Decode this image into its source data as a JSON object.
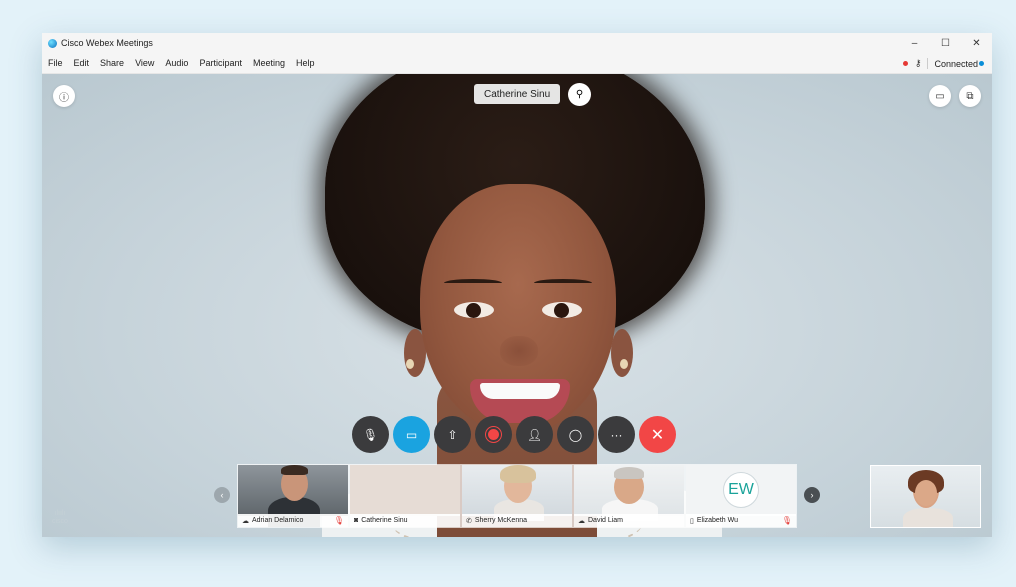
{
  "window": {
    "title": "Cisco Webex Meetings"
  },
  "window_controls": {
    "minimize": "–",
    "maximize": "☐",
    "close": "✕"
  },
  "menu": [
    "File",
    "Edit",
    "Share",
    "View",
    "Audio",
    "Participant",
    "Meeting",
    "Help"
  ],
  "status": {
    "connection": "Connected"
  },
  "stage": {
    "active_speaker": "Catherine Sinu"
  },
  "controls": [
    {
      "name": "mute",
      "icon": "mic-off-icon"
    },
    {
      "name": "video",
      "icon": "camera-icon"
    },
    {
      "name": "share",
      "icon": "upload-icon"
    },
    {
      "name": "record",
      "icon": "record-icon"
    },
    {
      "name": "participants",
      "icon": "participants-icon"
    },
    {
      "name": "chat",
      "icon": "chat-icon"
    },
    {
      "name": "more",
      "icon": "more-icon",
      "label": "···"
    },
    {
      "name": "end",
      "icon": "close-icon",
      "label": "✕"
    }
  ],
  "participants": [
    {
      "name": "Adrian Delamico",
      "device": "cloud-icon",
      "muted": true
    },
    {
      "name": "Catherine Sinu",
      "device": "camera-icon",
      "muted": false
    },
    {
      "name": "Sherry McKenna",
      "device": "phone-icon",
      "muted": false
    },
    {
      "name": "David Liam",
      "device": "cloud-icon",
      "muted": false
    },
    {
      "name": "Elizabeth Wu",
      "device": "mobile-icon",
      "muted": true,
      "initials": "EW"
    }
  ],
  "brand": {
    "logo_text": "cisco",
    "accent": "#1aa3e0",
    "end_call": "#f24646"
  }
}
